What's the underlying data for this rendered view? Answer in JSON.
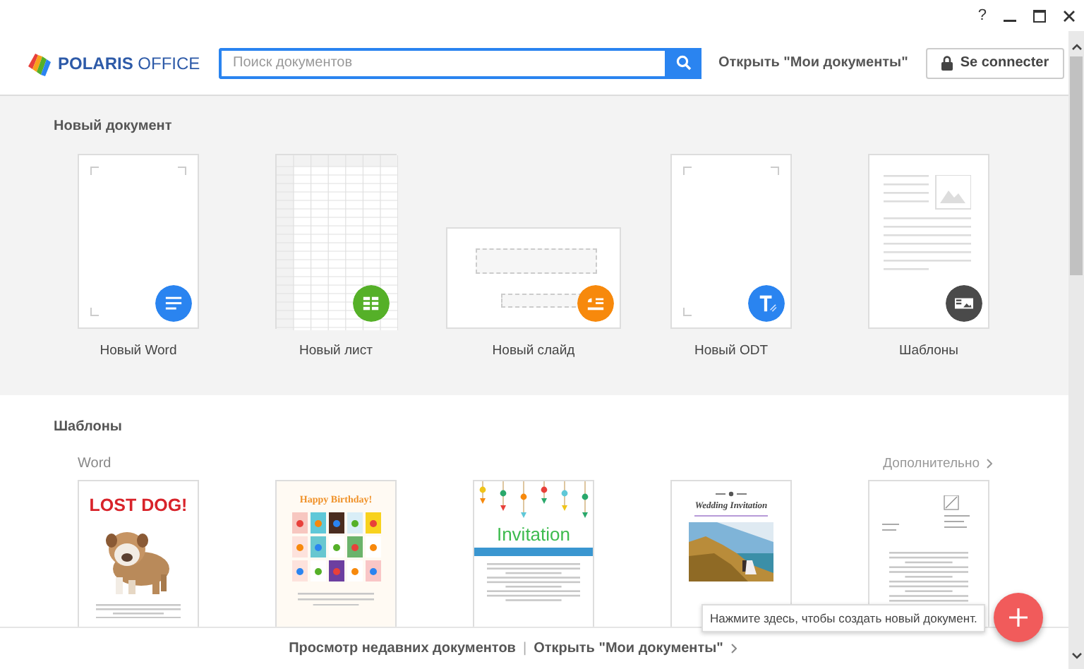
{
  "window": {
    "help": "?"
  },
  "header": {
    "logo": "**POLARIS** OFFICE",
    "search": {
      "placeholder": "Поиск документов"
    },
    "open_link": "Открыть \"Мои документы\"",
    "login_button": "Se connecter"
  },
  "new_document": {
    "title": "Новый документ",
    "items": [
      {
        "kind": "word",
        "label": "Новый Word",
        "color": "#2a84f0"
      },
      {
        "kind": "sheet",
        "label": "Новый лист",
        "color": "#55b028"
      },
      {
        "kind": "slide",
        "label": "Новый слайд",
        "color": "#f7890c"
      },
      {
        "kind": "odt",
        "label": "Новый ODT",
        "color": "#2a84f0"
      },
      {
        "kind": "templates",
        "label": "Шаблоны",
        "color": "#4a4a4a"
      }
    ]
  },
  "templates": {
    "title": "Шаблоны",
    "category": "Word",
    "more_link": "Дополнительно",
    "items": [
      {
        "kind": "poster",
        "heading": "LOST DOG!"
      },
      {
        "kind": "birthday",
        "heading": "Happy Birthday!"
      },
      {
        "kind": "invitation",
        "heading": "Invitation"
      },
      {
        "kind": "wedding",
        "heading": "Wedding Invitation"
      },
      {
        "kind": "letter"
      }
    ]
  },
  "footer": {
    "recent_link": "Просмотр недавних документов",
    "separator": "|",
    "open_link": "Открыть \"Мои документы\""
  },
  "tooltip": "Нажмите здесь, чтобы создать новый документ."
}
